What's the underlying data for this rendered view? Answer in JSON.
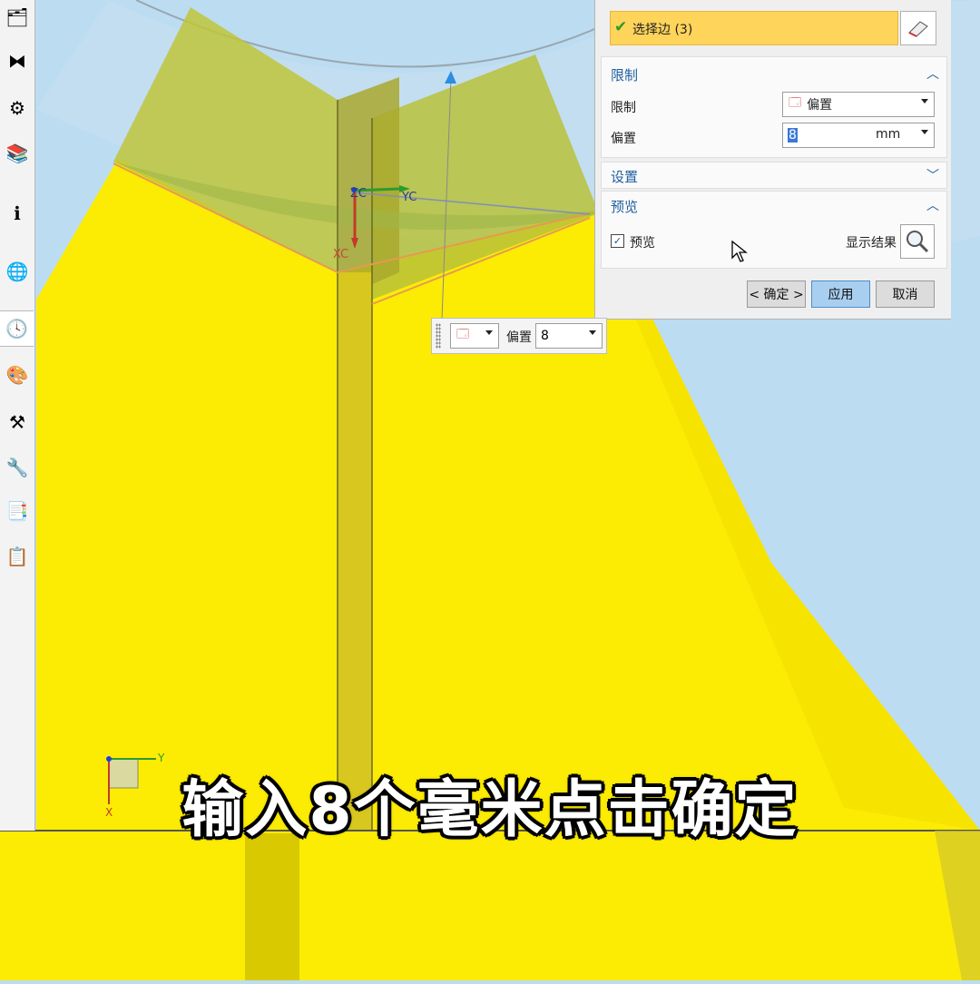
{
  "viewport": {
    "axis_labels": {
      "zc": "ZC",
      "yc": "YC",
      "xc": "XC"
    },
    "triad_labels": {
      "y": "Y",
      "x": "X"
    },
    "colors": {
      "sky": "#bcdcf2",
      "yellow": "#fcec04",
      "plate": "#cfc239",
      "axis_green": "#2e9a2e",
      "axis_red": "#c23a2a",
      "axis_blue": "#1f3fd1"
    }
  },
  "left_toolbar": {
    "icons": [
      "assembly-navigator-icon",
      "constraint-navigator-icon",
      "part-navigator-icon",
      "reuse-library-icon",
      "information-feed-icon",
      "web-browser-icon",
      "history-clock-icon",
      "visualization-palette-icon",
      "roles-icon",
      "system-materials-icon",
      "process-studio-icon",
      "manufacturing-wizard-icon"
    ]
  },
  "dialog": {
    "selection": {
      "label": "选择边 (3)",
      "status": "check-icon"
    },
    "limit_section": {
      "header": "限制",
      "limit_label": "限制",
      "limit_value": "偏置",
      "offset_label": "偏置",
      "offset_value": "8",
      "offset_unit": "mm"
    },
    "settings_section": {
      "header": "设置"
    },
    "preview_section": {
      "header": "预览",
      "preview_checkbox": "预览",
      "preview_checked": true,
      "show_result": "显示结果"
    },
    "buttons": {
      "ok": "< 确定 >",
      "apply": "应用",
      "cancel": "取消"
    }
  },
  "minibar": {
    "offset_label": "偏置",
    "offset_value": "8"
  },
  "caption": "输入8个毫米点击确定"
}
